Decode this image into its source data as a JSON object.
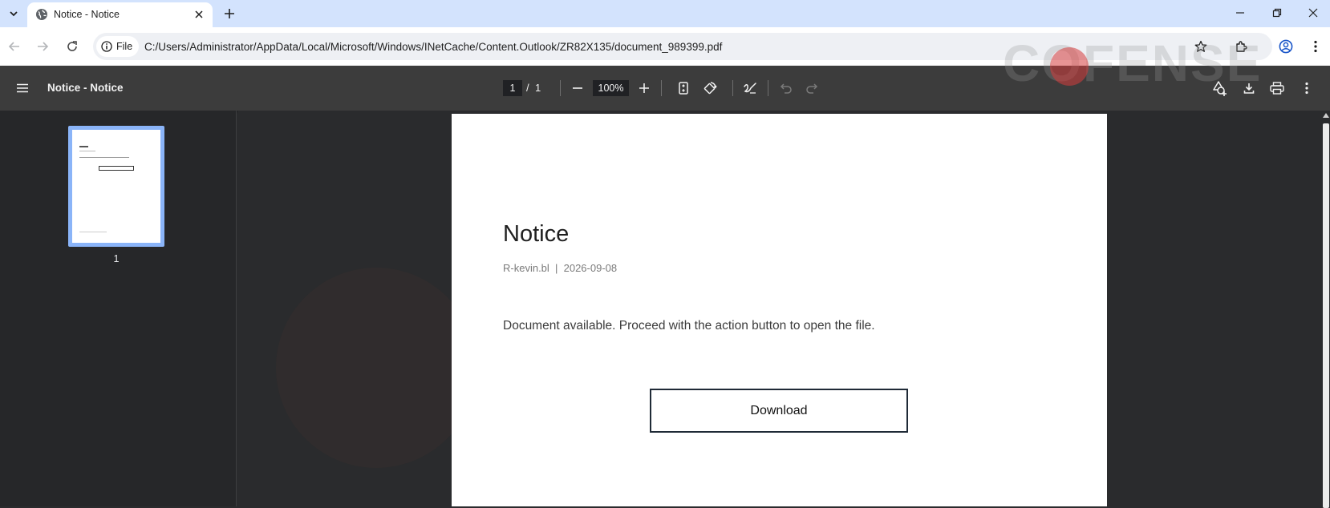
{
  "browser": {
    "tab": {
      "title": "Notice - Notice"
    },
    "address": {
      "chip_label": "File",
      "url": "C:/Users/Administrator/AppData/Local/Microsoft/Windows/INetCache/Content.Outlook/ZR82X135/document_989399.pdf"
    }
  },
  "pdf_toolbar": {
    "title": "Notice - Notice",
    "current_page": "1",
    "page_separator": "/",
    "total_pages": "1",
    "zoom": "100%"
  },
  "sidebar": {
    "thumbnails": [
      {
        "page_number": "1"
      }
    ]
  },
  "document": {
    "title": "Notice",
    "meta": "R-kevin.bl  |  2026-09-08",
    "body": "Document available. Proceed with the action button to open the file.",
    "button_label": "Download"
  },
  "watermark": {
    "text": "COFENSE"
  },
  "colors": {
    "tabstrip": "#d3e3fd",
    "pdf_toolbar": "#3c3c3c",
    "viewer_bg": "#2a2b2d",
    "thumbnail_highlight": "#8ab4f8"
  }
}
